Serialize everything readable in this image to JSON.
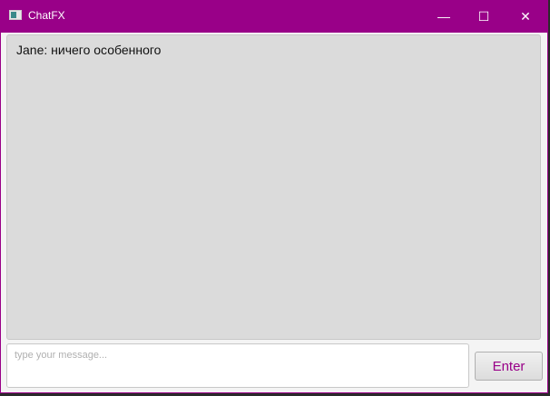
{
  "window": {
    "title": "ChatFX",
    "minimize": "—",
    "maximize": "☐",
    "close": "✕"
  },
  "chat": {
    "messages": [
      "Jane: ничего особенного"
    ]
  },
  "input": {
    "placeholder": "type your message...",
    "value": ""
  },
  "send_button": {
    "label": "Enter"
  },
  "colors": {
    "accent": "#990088",
    "chat_bg": "#dbdbdb"
  }
}
